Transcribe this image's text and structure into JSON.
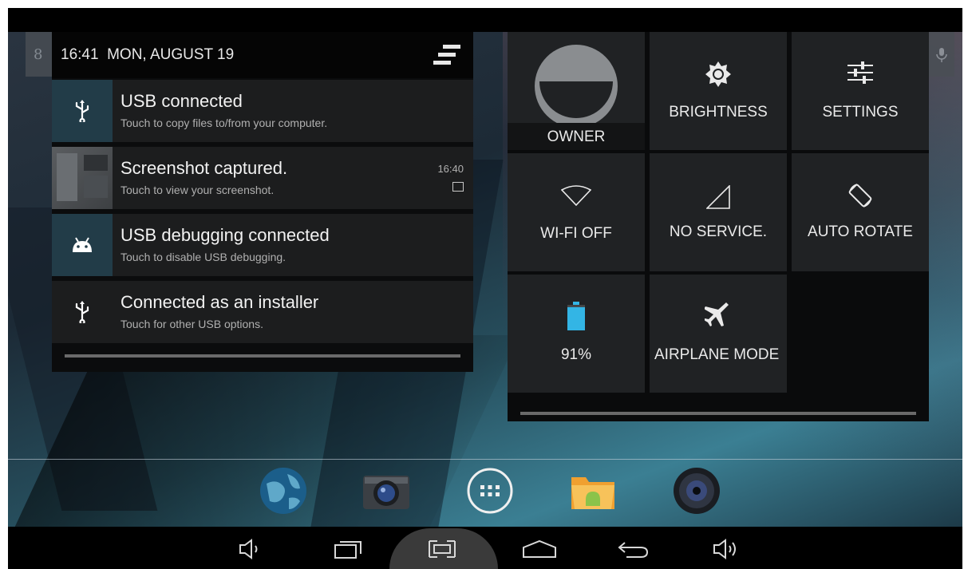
{
  "status": {
    "time": "16:41",
    "date": "MON, AUGUST 19",
    "left_hint": "8"
  },
  "notifications": [
    {
      "title": "USB connected",
      "subtitle": "Touch to copy files to/from your computer.",
      "icon": "usb-icon",
      "timestamp": ""
    },
    {
      "title": "Screenshot captured.",
      "subtitle": "Touch to view your screenshot.",
      "icon": "screenshot-thumbnail",
      "timestamp": "16:40"
    },
    {
      "title": "USB debugging connected",
      "subtitle": "Touch to disable USB debugging.",
      "icon": "android-debug-icon",
      "timestamp": ""
    },
    {
      "title": "Connected as an installer",
      "subtitle": "Touch for other USB options.",
      "icon": "usb-icon",
      "timestamp": ""
    }
  ],
  "quick_settings": {
    "owner": "OWNER",
    "brightness": "BRIGHTNESS",
    "settings": "SETTINGS",
    "wifi": "WI-FI OFF",
    "signal": "NO SERVICE.",
    "rotate": "AUTO ROTATE",
    "battery": "91%",
    "battery_level": 0.91,
    "airplane": "AIRPLANE MODE"
  },
  "dock": [
    "browser-icon",
    "camera-icon",
    "app-drawer-icon",
    "file-manager-icon",
    "music-icon"
  ],
  "navbar": [
    "volume-down-icon",
    "recent-apps-icon",
    "screenshot-icon",
    "home-icon",
    "back-icon",
    "volume-up-icon"
  ],
  "colors": {
    "accent": "#33b5e5",
    "tile": "#202224",
    "notif_icon_bg": "#223c48"
  }
}
